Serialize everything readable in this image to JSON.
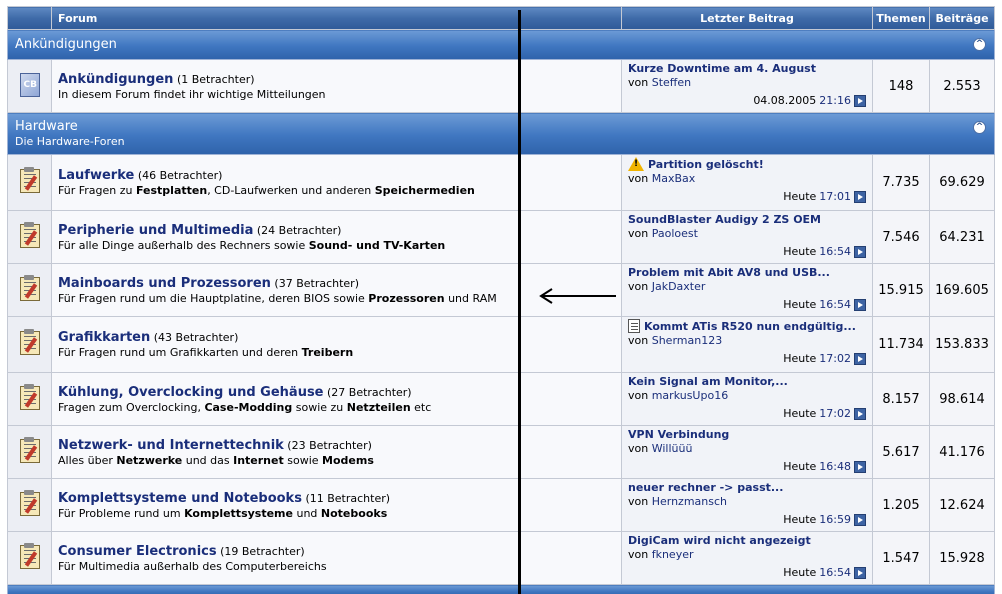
{
  "header": {
    "forum": "Forum",
    "last_post": "Letzter Beitrag",
    "topics": "Themen",
    "posts": "Beiträge"
  },
  "categories": [
    {
      "title": "Ankündigungen",
      "desc": ""
    },
    {
      "title": "Hardware",
      "desc": "Die Hardware-Foren"
    }
  ],
  "forums": [
    {
      "name": "Ankündigungen",
      "viewers": "(1 Betrachter)",
      "desc": "In diesem Forum findet ihr wichtige Mitteilungen",
      "last_title": "Kurze Downtime am 4. August",
      "by": "von",
      "user": "Steffen",
      "date": "04.08.2005",
      "time": "21:16",
      "topics": "148",
      "posts": "2.553",
      "icon": "cb-logo-icon"
    },
    {
      "name": "Laufwerke",
      "viewers": "(46 Betrachter)",
      "desc": "Für Fragen zu Festplatten, CD-Laufwerken und anderen Speichermedien",
      "last_title": "Partition gelöscht!",
      "by": "von",
      "user": "MaxBax",
      "date": "Heute",
      "time": "17:01",
      "topics": "7.735",
      "posts": "69.629",
      "icon": "forum-icon",
      "post_icon": "warning-icon"
    },
    {
      "name": "Peripherie und Multimedia",
      "viewers": "(24 Betrachter)",
      "desc": "Für alle Dinge außerhalb des Rechners sowie Sound- und TV-Karten",
      "last_title": "SoundBlaster Audigy 2 ZS OEM",
      "by": "von",
      "user": "Paoloest",
      "date": "Heute",
      "time": "16:54",
      "topics": "7.546",
      "posts": "64.231",
      "icon": "forum-icon"
    },
    {
      "name": "Mainboards und Prozessoren",
      "viewers": "(37 Betrachter)",
      "desc": "Für Fragen rund um die Hauptplatine, deren BIOS sowie Prozessoren und RAM",
      "last_title": "Problem mit Abit AV8 und USB...",
      "by": "von",
      "user": "JakDaxter",
      "date": "Heute",
      "time": "16:54",
      "topics": "15.915",
      "posts": "169.605",
      "icon": "forum-icon"
    },
    {
      "name": "Grafikkarten",
      "viewers": "(43 Betrachter)",
      "desc": "Für Fragen rund um Grafikkarten und deren Treibern",
      "last_title": "Kommt ATis R520 nun endgültig...",
      "by": "von",
      "user": "Sherman123",
      "date": "Heute",
      "time": "17:02",
      "topics": "11.734",
      "posts": "153.833",
      "icon": "forum-icon",
      "post_icon": "document-icon"
    },
    {
      "name": "Kühlung, Overclocking und Gehäuse",
      "viewers": "(27 Betrachter)",
      "desc": "Fragen zum Overclocking, Case-Modding sowie zu Netzteilen etc",
      "last_title": "Kein Signal am Monitor,...",
      "by": "von",
      "user": "markusUpo16",
      "date": "Heute",
      "time": "17:02",
      "topics": "8.157",
      "posts": "98.614",
      "icon": "forum-icon"
    },
    {
      "name": "Netzwerk- und Internettechnik",
      "viewers": "(23 Betrachter)",
      "desc": "Alles über Netzwerke und das Internet sowie Modems",
      "last_title": "VPN Verbindung",
      "by": "von",
      "user": "Willüüü",
      "date": "Heute",
      "time": "16:48",
      "topics": "5.617",
      "posts": "41.176",
      "icon": "forum-icon"
    },
    {
      "name": "Komplettsysteme und Notebooks",
      "viewers": "(11 Betrachter)",
      "desc": "Für Probleme rund um Komplettsysteme und Notebooks",
      "last_title": "neuer rechner -> passt...",
      "by": "von",
      "user": "Hernzmansch",
      "date": "Heute",
      "time": "16:59",
      "topics": "1.205",
      "posts": "12.624",
      "icon": "forum-icon"
    },
    {
      "name": "Consumer Electronics",
      "viewers": "(19 Betrachter)",
      "desc": "Für Multimedia außerhalb des Computerbereichs",
      "last_title": "DigiCam wird nicht angezeigt",
      "by": "von",
      "user": "fkneyer",
      "date": "Heute",
      "time": "16:54",
      "topics": "1.547",
      "posts": "15.928",
      "icon": "forum-icon"
    }
  ],
  "colors": {
    "header_blue": "#3e6aa8",
    "link_navy": "#1a2e7a",
    "row_bg": "#f4f5f9"
  }
}
